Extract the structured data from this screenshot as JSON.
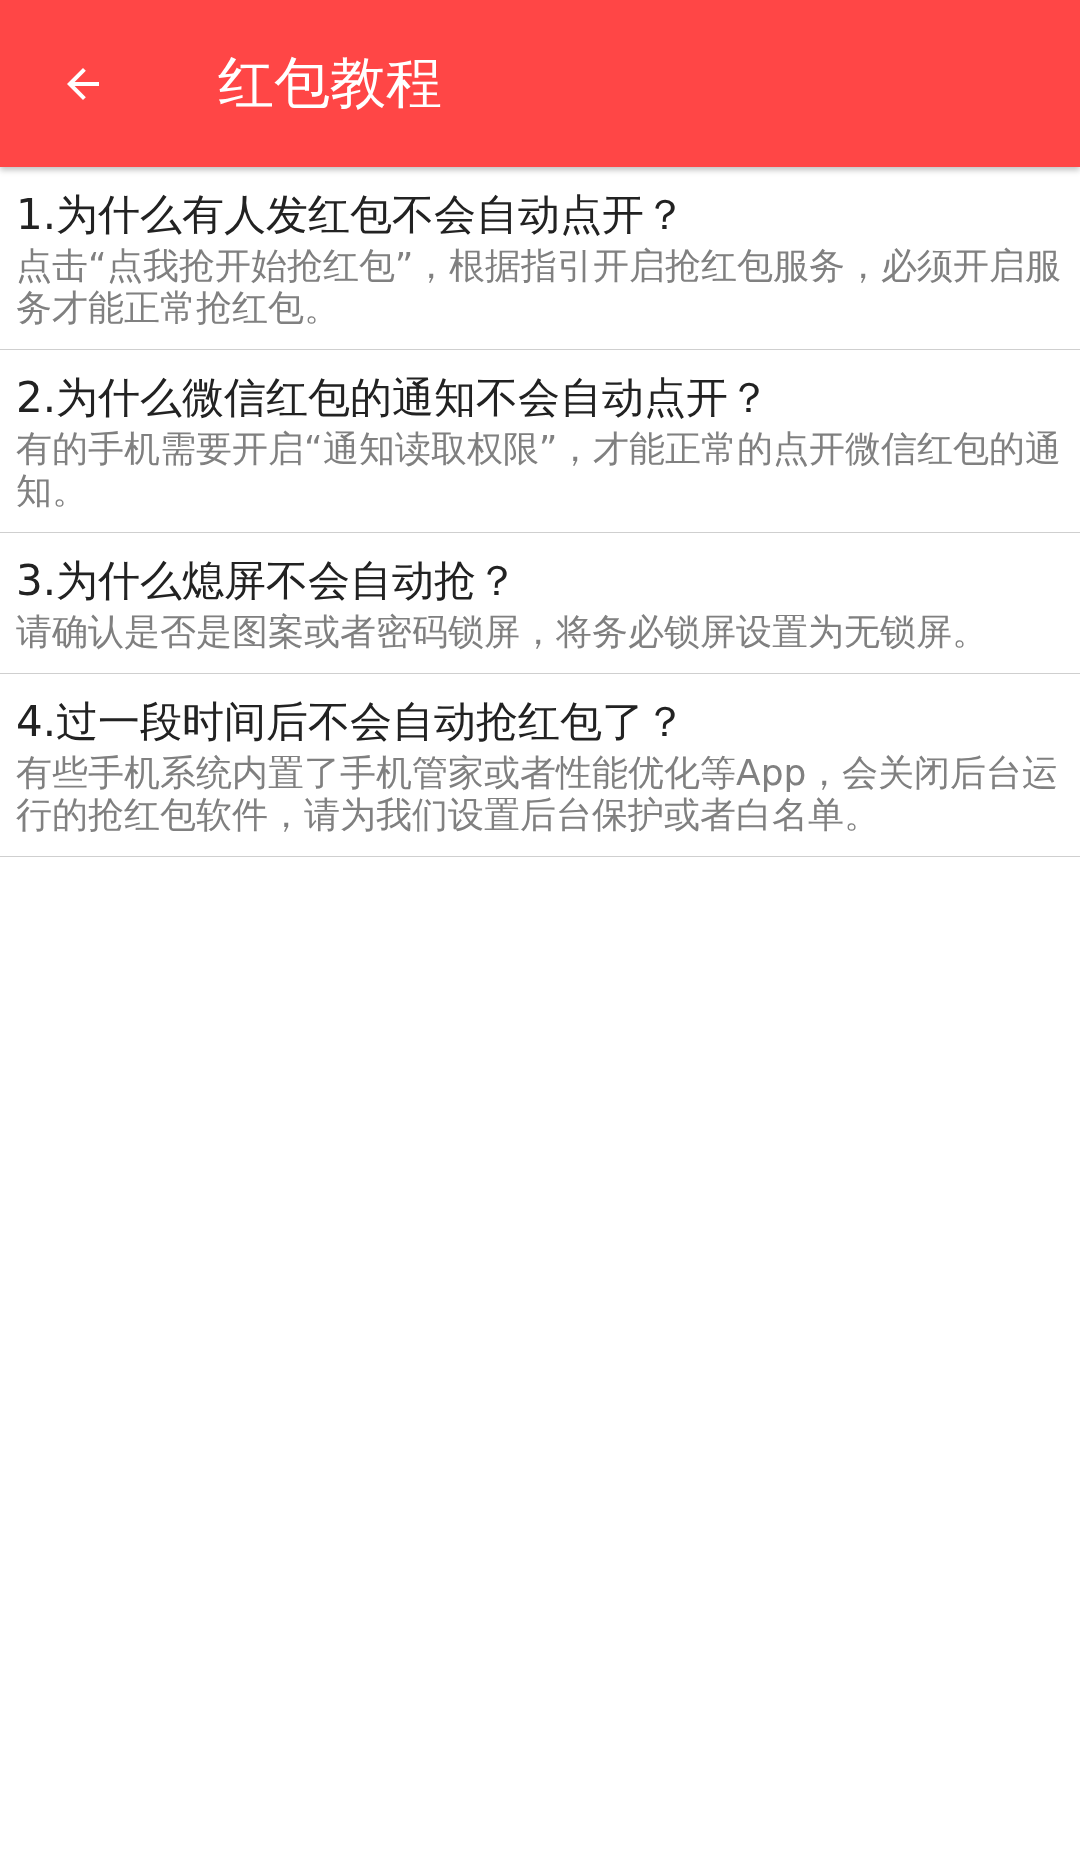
{
  "app_bar": {
    "title": "红包教程"
  },
  "faq": [
    {
      "question": "1.为什么有人发红包不会自动点开？",
      "answer": "点击“点我抢开始抢红包”，根据指引开启抢红包服务，必须开启服务才能正常抢红包。"
    },
    {
      "question": "2.为什么微信红包的通知不会自动点开？",
      "answer": "有的手机需要开启“通知读取权限”，才能正常的点开微信红包的通知。"
    },
    {
      "question": "3.为什么熄屏不会自动抢？",
      "answer": "请确认是否是图案或者密码锁屏，将务必锁屏设置为无锁屏。"
    },
    {
      "question": "4.过一段时间后不会自动抢红包了？",
      "answer": "有些手机系统内置了手机管家或者性能优化等App，会关闭后台运行的抢红包软件，请为我们设置后台保护或者白名单。"
    }
  ]
}
